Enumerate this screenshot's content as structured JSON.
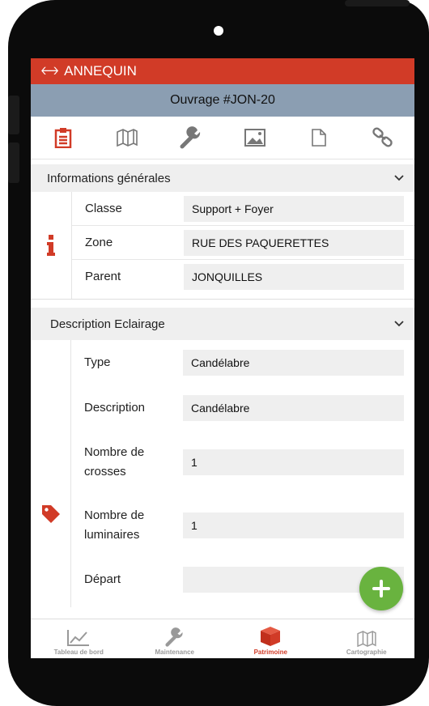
{
  "app": {
    "back_label": "ANNEQUIN",
    "title": "Ouvrage #JON-20"
  },
  "tabs": [
    {
      "icon": "clipboard-icon",
      "active": true
    },
    {
      "icon": "map-icon"
    },
    {
      "icon": "wrench-icon"
    },
    {
      "icon": "image-icon"
    },
    {
      "icon": "document-icon"
    },
    {
      "icon": "link-icon"
    }
  ],
  "info_section": {
    "title": "Informations générales",
    "rows": [
      {
        "label": "Classe",
        "value": "Support + Foyer"
      },
      {
        "label": "Zone",
        "value": "RUE DES PAQUERETTES"
      },
      {
        "label": "Parent",
        "value": "JONQUILLES"
      }
    ]
  },
  "desc_section": {
    "title": "Description Eclairage",
    "rows": [
      {
        "label": "Type",
        "value": "Candélabre"
      },
      {
        "label": "Description",
        "value": "Candélabre"
      },
      {
        "label": "Nombre de crosses",
        "value": "1"
      },
      {
        "label": "Nombre de luminaires",
        "value": "1"
      },
      {
        "label": "Départ",
        "value": ""
      }
    ]
  },
  "bottom_nav": [
    {
      "label": "Tableau de bord",
      "icon": "chart-icon"
    },
    {
      "label": "Maintenance",
      "icon": "wrench-icon"
    },
    {
      "label": "Patrimoine",
      "icon": "cube-icon",
      "active": true
    },
    {
      "label": "Cartographie",
      "icon": "map-icon"
    }
  ],
  "colors": {
    "accent": "#d13b27",
    "title_bar": "#8b9eb2",
    "fab": "#69b33f"
  }
}
